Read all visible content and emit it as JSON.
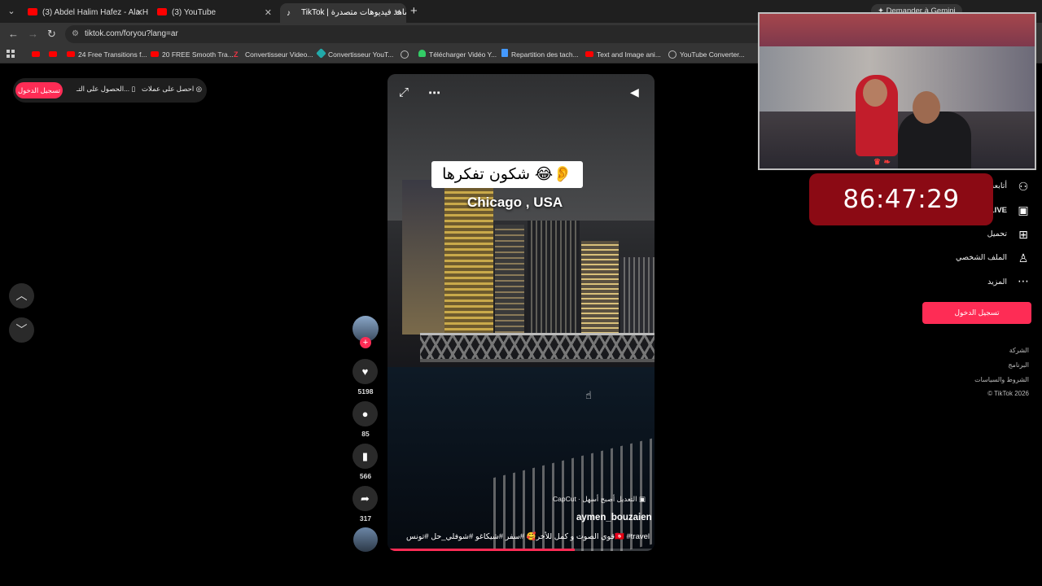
{
  "browser": {
    "tabs": [
      {
        "title": "(3) Abdel Halim Hafez - Ala Hes",
        "icon": "youtube-icon"
      },
      {
        "title": "(3) YouTube",
        "icon": "youtube-icon"
      },
      {
        "title": "TikTok | شاهد فيديوهات متصدرة",
        "icon": "tiktok-icon"
      }
    ],
    "url": "tiktok.com/foryou?lang=ar",
    "gemini": "Demander à Gemini",
    "bookmarks": [
      {
        "label": "",
        "icon": "youtube-icon"
      },
      {
        "label": "",
        "icon": "youtube-icon"
      },
      {
        "label": "24 Free Transitions f...",
        "icon": "youtube-icon"
      },
      {
        "label": "20 FREE Smooth Tra...",
        "icon": "youtube-icon"
      },
      {
        "label": "Convertisseur Video...",
        "icon": "z-icon"
      },
      {
        "label": "Convertisseur YouT...",
        "icon": "converter-icon"
      },
      {
        "label": "",
        "icon": "globe-icon"
      },
      {
        "label": "Télécharger Vidéo Y...",
        "icon": "download-icon"
      },
      {
        "label": "Repartition des tach...",
        "icon": "doc-icon"
      },
      {
        "label": "Text and Image ani...",
        "icon": "youtube-icon"
      },
      {
        "label": "YouTube Converter...",
        "icon": "globe-icon"
      }
    ]
  },
  "topbar": {
    "login": "تسجيل الدخول",
    "get_app": "الحصول على التـ...",
    "get_coins": "احصل على عملات"
  },
  "video": {
    "caption": "شكون تفكرها 😂👂",
    "location": "Chicago , USA",
    "capcut": "CapCut · التعديل أصبح أسهل",
    "author": "aymen_bouzaien",
    "description": "قوي الصوت و كمل للأخر🥰 #سفر #شيكاغو #شوفلي_حل #تونس🇹🇳 #travel",
    "progress": 0.7
  },
  "rail": {
    "likes": "5198",
    "comments": "85",
    "saves": "566",
    "shares": "317"
  },
  "sidebar": {
    "items": [
      {
        "label": "أتابعه",
        "icon": "following-icon"
      },
      {
        "label": "LIVE",
        "icon": "live-icon"
      },
      {
        "label": "تحميل",
        "icon": "upload-icon"
      },
      {
        "label": "الملف الشخصي",
        "icon": "profile-icon"
      },
      {
        "label": "المزيد",
        "icon": "more-icon"
      }
    ],
    "login": "تسجيل الدخول",
    "footer": [
      "الشركة",
      "البرنامج",
      "الشروط والسياسات",
      "© TikTok 2026"
    ]
  },
  "overlay": {
    "timer": "86:47:29"
  },
  "colors": {
    "accent": "#fe2c55",
    "timer_bg": "#8b0a14"
  }
}
